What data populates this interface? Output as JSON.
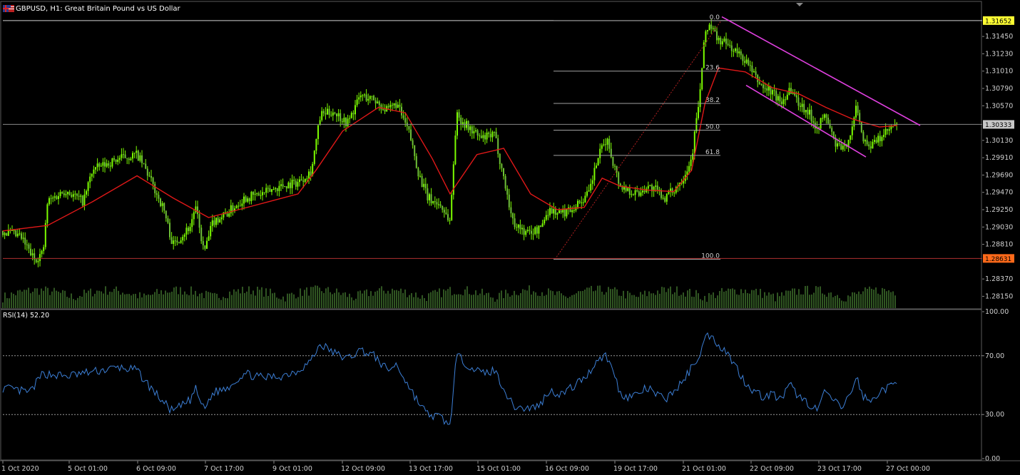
{
  "header": {
    "symbol_title": "GBPUSD, H1:  Great Britain Pound vs US Dollar",
    "flags_icon": "gb-us-flags-icon"
  },
  "rsi_title": "RSI(14) 52.20",
  "colors": {
    "background": "#000000",
    "candle_up": "#7CFC00",
    "candle_down": "#6fbf3a",
    "ma": "#e01818",
    "rsi_line": "#3c7fd6",
    "channel": "#e040e0",
    "fib": "#a0a0a0",
    "fib_trend": "#b02020",
    "axis_text": "#cfcfcf",
    "hline": "#888888",
    "support_line": "#b03030",
    "price_badge_high": "#ffff33",
    "price_badge_current": "#c8c8c8",
    "price_badge_low": "#ff6a1a"
  },
  "chart_data": [
    {
      "type": "candlestick",
      "symbol": "GBPUSD",
      "timeframe": "H1",
      "ylim": [
        1.28,
        1.3175
      ],
      "price_ticks": [
        "1.31450",
        "1.31230",
        "1.31010",
        "1.30790",
        "1.30570",
        "1.30130",
        "1.29910",
        "1.29690",
        "1.29470",
        "1.29250",
        "1.29030",
        "1.28810",
        "1.28370",
        "1.28150"
      ],
      "price_tick_values": [
        1.3145,
        1.3123,
        1.3101,
        1.3079,
        1.3057,
        1.3013,
        1.2991,
        1.2969,
        1.2947,
        1.2925,
        1.2903,
        1.2881,
        1.2837,
        1.2815
      ],
      "x_labels": [
        "1 Oct 2020",
        "5 Oct 01:00",
        "6 Oct 09:00",
        "7 Oct 17:00",
        "9 Oct 01:00",
        "12 Oct 09:00",
        "13 Oct 17:00",
        "15 Oct 01:00",
        "16 Oct 09:00",
        "19 Oct 17:00",
        "21 Oct 01:00",
        "22 Oct 09:00",
        "23 Oct 17:00",
        "27 Oct 00:00"
      ],
      "price_path": [
        [
          0,
          1.2898
        ],
        [
          0.02,
          1.289
        ],
        [
          0.035,
          1.2862
        ],
        [
          0.045,
          1.287
        ],
        [
          0.05,
          1.2935
        ],
        [
          0.07,
          1.295
        ],
        [
          0.09,
          1.2935
        ],
        [
          0.1,
          1.2975
        ],
        [
          0.13,
          1.299
        ],
        [
          0.15,
          1.2995
        ],
        [
          0.16,
          1.2975
        ],
        [
          0.18,
          1.2925
        ],
        [
          0.19,
          1.288
        ],
        [
          0.21,
          1.2905
        ],
        [
          0.215,
          1.293
        ],
        [
          0.225,
          1.287
        ],
        [
          0.235,
          1.291
        ],
        [
          0.25,
          1.292
        ],
        [
          0.27,
          1.294
        ],
        [
          0.29,
          1.2945
        ],
        [
          0.31,
          1.2955
        ],
        [
          0.33,
          1.296
        ],
        [
          0.345,
          1.2975
        ],
        [
          0.355,
          1.3045
        ],
        [
          0.37,
          1.305
        ],
        [
          0.385,
          1.3035
        ],
        [
          0.4,
          1.307
        ],
        [
          0.415,
          1.3065
        ],
        [
          0.43,
          1.305
        ],
        [
          0.44,
          1.306
        ],
        [
          0.455,
          1.302
        ],
        [
          0.465,
          1.297
        ],
        [
          0.475,
          1.294
        ],
        [
          0.49,
          1.293
        ],
        [
          0.5,
          1.291
        ],
        [
          0.507,
          1.3045
        ],
        [
          0.52,
          1.303
        ],
        [
          0.535,
          1.3015
        ],
        [
          0.55,
          1.302
        ],
        [
          0.56,
          1.2965
        ],
        [
          0.57,
          1.291
        ],
        [
          0.585,
          1.2895
        ],
        [
          0.6,
          1.29
        ],
        [
          0.61,
          1.2925
        ],
        [
          0.625,
          1.292
        ],
        [
          0.64,
          1.293
        ],
        [
          0.655,
          1.2945
        ],
        [
          0.665,
          1.299
        ],
        [
          0.675,
          1.3015
        ],
        [
          0.685,
          1.2975
        ],
        [
          0.69,
          1.2955
        ],
        [
          0.7,
          1.295
        ],
        [
          0.71,
          1.2945
        ],
        [
          0.72,
          1.2955
        ],
        [
          0.73,
          1.295
        ],
        [
          0.74,
          1.294
        ],
        [
          0.75,
          1.295
        ],
        [
          0.76,
          1.2965
        ],
        [
          0.77,
          1.299
        ],
        [
          0.78,
          1.308
        ],
        [
          0.785,
          1.315
        ],
        [
          0.79,
          1.316
        ],
        [
          0.8,
          1.314
        ],
        [
          0.81,
          1.3135
        ],
        [
          0.82,
          1.3125
        ],
        [
          0.83,
          1.3115
        ],
        [
          0.84,
          1.3095
        ],
        [
          0.85,
          1.308
        ],
        [
          0.86,
          1.3075
        ],
        [
          0.87,
          1.306
        ],
        [
          0.88,
          1.308
        ],
        [
          0.89,
          1.306
        ],
        [
          0.9,
          1.305
        ],
        [
          0.91,
          1.303
        ],
        [
          0.92,
          1.3045
        ],
        [
          0.93,
          1.301
        ],
        [
          0.94,
          1.3
        ],
        [
          0.95,
          1.303
        ],
        [
          0.955,
          1.306
        ],
        [
          0.96,
          1.302
        ],
        [
          0.97,
          1.3005
        ],
        [
          0.98,
          1.3015
        ],
        [
          0.99,
          1.3025
        ],
        [
          1.0,
          1.3034
        ]
      ],
      "moving_average_path": [
        [
          0,
          1.2898
        ],
        [
          0.05,
          1.2905
        ],
        [
          0.1,
          1.2935
        ],
        [
          0.15,
          1.2968
        ],
        [
          0.19,
          1.294
        ],
        [
          0.23,
          1.2915
        ],
        [
          0.28,
          1.293
        ],
        [
          0.33,
          1.2945
        ],
        [
          0.35,
          1.2975
        ],
        [
          0.38,
          1.3025
        ],
        [
          0.42,
          1.3055
        ],
        [
          0.45,
          1.3048
        ],
        [
          0.48,
          1.299
        ],
        [
          0.5,
          1.2945
        ],
        [
          0.53,
          1.2995
        ],
        [
          0.56,
          1.3003
        ],
        [
          0.59,
          1.2945
        ],
        [
          0.62,
          1.2925
        ],
        [
          0.65,
          1.2928
        ],
        [
          0.67,
          1.2965
        ],
        [
          0.69,
          1.2955
        ],
        [
          0.72,
          1.295
        ],
        [
          0.75,
          1.2948
        ],
        [
          0.77,
          1.2975
        ],
        [
          0.785,
          1.306
        ],
        [
          0.8,
          1.3105
        ],
        [
          0.83,
          1.31
        ],
        [
          0.86,
          1.308
        ],
        [
          0.89,
          1.3072
        ],
        [
          0.92,
          1.3055
        ],
        [
          0.95,
          1.304
        ],
        [
          0.98,
          1.303
        ],
        [
          1.0,
          1.3032
        ]
      ],
      "fibonacci": [
        {
          "label": "0.0",
          "value": 1.3165
        },
        {
          "label": "23.6",
          "value": 1.3101
        },
        {
          "label": "38.2",
          "value": 1.306
        },
        {
          "label": "50.0",
          "value": 1.3026
        },
        {
          "label": "61.8",
          "value": 1.2994
        },
        {
          "label": "100.0",
          "value": 1.2862
        }
      ],
      "price_badges": [
        {
          "label": "1.31652",
          "value": 1.31652,
          "style": "high"
        },
        {
          "label": "1.30333",
          "value": 1.30333,
          "style": "current"
        },
        {
          "label": "1.28631",
          "value": 1.28631,
          "style": "low"
        }
      ]
    },
    {
      "type": "line",
      "name": "RSI(14)",
      "ylim": [
        0,
        100
      ],
      "y_ticks": [
        "100.00",
        "70.00",
        "30.00",
        "0.00"
      ],
      "y_tick_values": [
        100,
        70,
        30,
        0
      ],
      "levels": [
        70,
        30
      ],
      "current_value": 52.2,
      "rsi_path": [
        [
          0,
          48
        ],
        [
          0.03,
          45
        ],
        [
          0.045,
          58
        ],
        [
          0.07,
          56
        ],
        [
          0.09,
          58
        ],
        [
          0.11,
          60
        ],
        [
          0.13,
          62
        ],
        [
          0.15,
          60
        ],
        [
          0.16,
          52
        ],
        [
          0.18,
          38
        ],
        [
          0.19,
          32
        ],
        [
          0.21,
          40
        ],
        [
          0.215,
          48
        ],
        [
          0.225,
          33
        ],
        [
          0.235,
          45
        ],
        [
          0.25,
          48
        ],
        [
          0.27,
          58
        ],
        [
          0.29,
          55
        ],
        [
          0.31,
          56
        ],
        [
          0.33,
          60
        ],
        [
          0.345,
          67
        ],
        [
          0.355,
          78
        ],
        [
          0.37,
          72
        ],
        [
          0.385,
          68
        ],
        [
          0.4,
          74
        ],
        [
          0.415,
          70
        ],
        [
          0.43,
          60
        ],
        [
          0.44,
          64
        ],
        [
          0.455,
          48
        ],
        [
          0.465,
          38
        ],
        [
          0.475,
          30
        ],
        [
          0.49,
          28
        ],
        [
          0.5,
          22
        ],
        [
          0.507,
          70
        ],
        [
          0.52,
          64
        ],
        [
          0.535,
          58
        ],
        [
          0.55,
          60
        ],
        [
          0.56,
          48
        ],
        [
          0.57,
          36
        ],
        [
          0.585,
          34
        ],
        [
          0.6,
          36
        ],
        [
          0.61,
          46
        ],
        [
          0.625,
          44
        ],
        [
          0.64,
          50
        ],
        [
          0.655,
          58
        ],
        [
          0.665,
          68
        ],
        [
          0.675,
          70
        ],
        [
          0.685,
          55
        ],
        [
          0.69,
          44
        ],
        [
          0.7,
          42
        ],
        [
          0.71,
          44
        ],
        [
          0.72,
          48
        ],
        [
          0.73,
          44
        ],
        [
          0.74,
          40
        ],
        [
          0.75,
          46
        ],
        [
          0.76,
          52
        ],
        [
          0.77,
          62
        ],
        [
          0.78,
          72
        ],
        [
          0.785,
          82
        ],
        [
          0.79,
          84
        ],
        [
          0.8,
          78
        ],
        [
          0.81,
          72
        ],
        [
          0.82,
          62
        ],
        [
          0.83,
          52
        ],
        [
          0.84,
          46
        ],
        [
          0.85,
          42
        ],
        [
          0.86,
          44
        ],
        [
          0.87,
          40
        ],
        [
          0.88,
          50
        ],
        [
          0.89,
          42
        ],
        [
          0.9,
          38
        ],
        [
          0.91,
          33
        ],
        [
          0.92,
          46
        ],
        [
          0.93,
          38
        ],
        [
          0.94,
          35
        ],
        [
          0.95,
          48
        ],
        [
          0.955,
          56
        ],
        [
          0.96,
          44
        ],
        [
          0.97,
          38
        ],
        [
          0.98,
          46
        ],
        [
          0.99,
          48
        ],
        [
          1.0,
          52
        ]
      ]
    }
  ]
}
